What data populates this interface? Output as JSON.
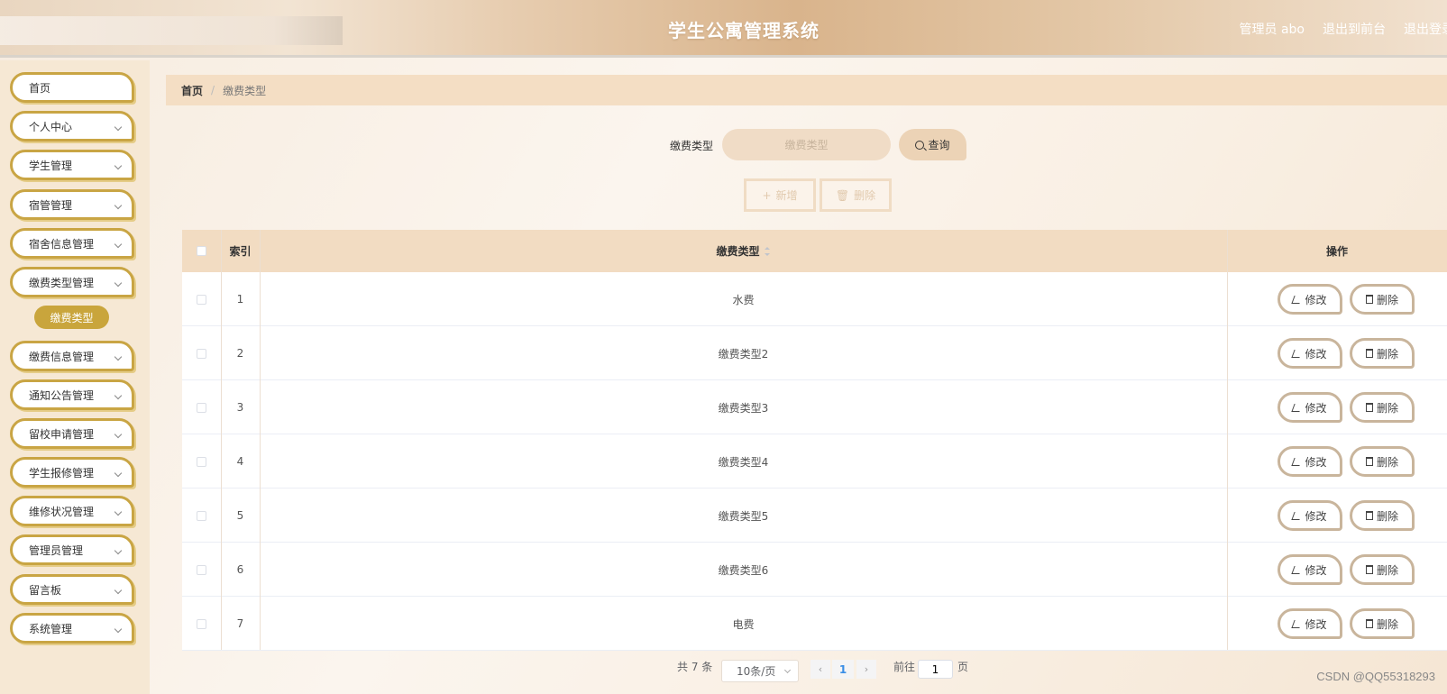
{
  "header": {
    "title": "学生公寓管理系统",
    "links": [
      "管理员 abo",
      "退出到前台",
      "退出登录"
    ]
  },
  "sidebar": {
    "items": [
      {
        "label": "首页",
        "has_children": false
      },
      {
        "label": "个人中心",
        "has_children": true
      },
      {
        "label": "学生管理",
        "has_children": true
      },
      {
        "label": "宿管管理",
        "has_children": true
      },
      {
        "label": "宿舍信息管理",
        "has_children": true
      },
      {
        "label": "缴费类型管理",
        "has_children": true
      },
      {
        "label": "缴费信息管理",
        "has_children": true
      },
      {
        "label": "通知公告管理",
        "has_children": true
      },
      {
        "label": "留校申请管理",
        "has_children": true
      },
      {
        "label": "学生报修管理",
        "has_children": true
      },
      {
        "label": "维修状况管理",
        "has_children": true
      },
      {
        "label": "管理员管理",
        "has_children": true
      },
      {
        "label": "留言板",
        "has_children": true
      },
      {
        "label": "系统管理",
        "has_children": true
      }
    ],
    "active_subitem": "缴费类型"
  },
  "breadcrumb": {
    "home": "首页",
    "separator": "/",
    "current": "缴费类型"
  },
  "search": {
    "label": "缴费类型",
    "placeholder": "缴费类型",
    "button": "查询"
  },
  "actions": {
    "add": "新增",
    "delete": "删除"
  },
  "table": {
    "headers": {
      "index": "索引",
      "type": "缴费类型",
      "ops": "操作"
    },
    "rows": [
      {
        "index": "1",
        "type": "水费"
      },
      {
        "index": "2",
        "type": "缴费类型2"
      },
      {
        "index": "3",
        "type": "缴费类型3"
      },
      {
        "index": "4",
        "type": "缴费类型4"
      },
      {
        "index": "5",
        "type": "缴费类型5"
      },
      {
        "index": "6",
        "type": "缴费类型6"
      },
      {
        "index": "7",
        "type": "电费"
      }
    ],
    "edit_label": "修改",
    "delete_label": "删除"
  },
  "pagination": {
    "total": "共 7 条",
    "page_size": "10条/页",
    "current_page": "1",
    "goto_label": "前往",
    "goto_value": "1",
    "page_suffix": "页"
  },
  "watermark": "CSDN @QQ55318293",
  "colors": {
    "accent": "#c9a544",
    "header_bg": "#f2dcc2",
    "breadcrumb_bg": "#f4dec4"
  }
}
